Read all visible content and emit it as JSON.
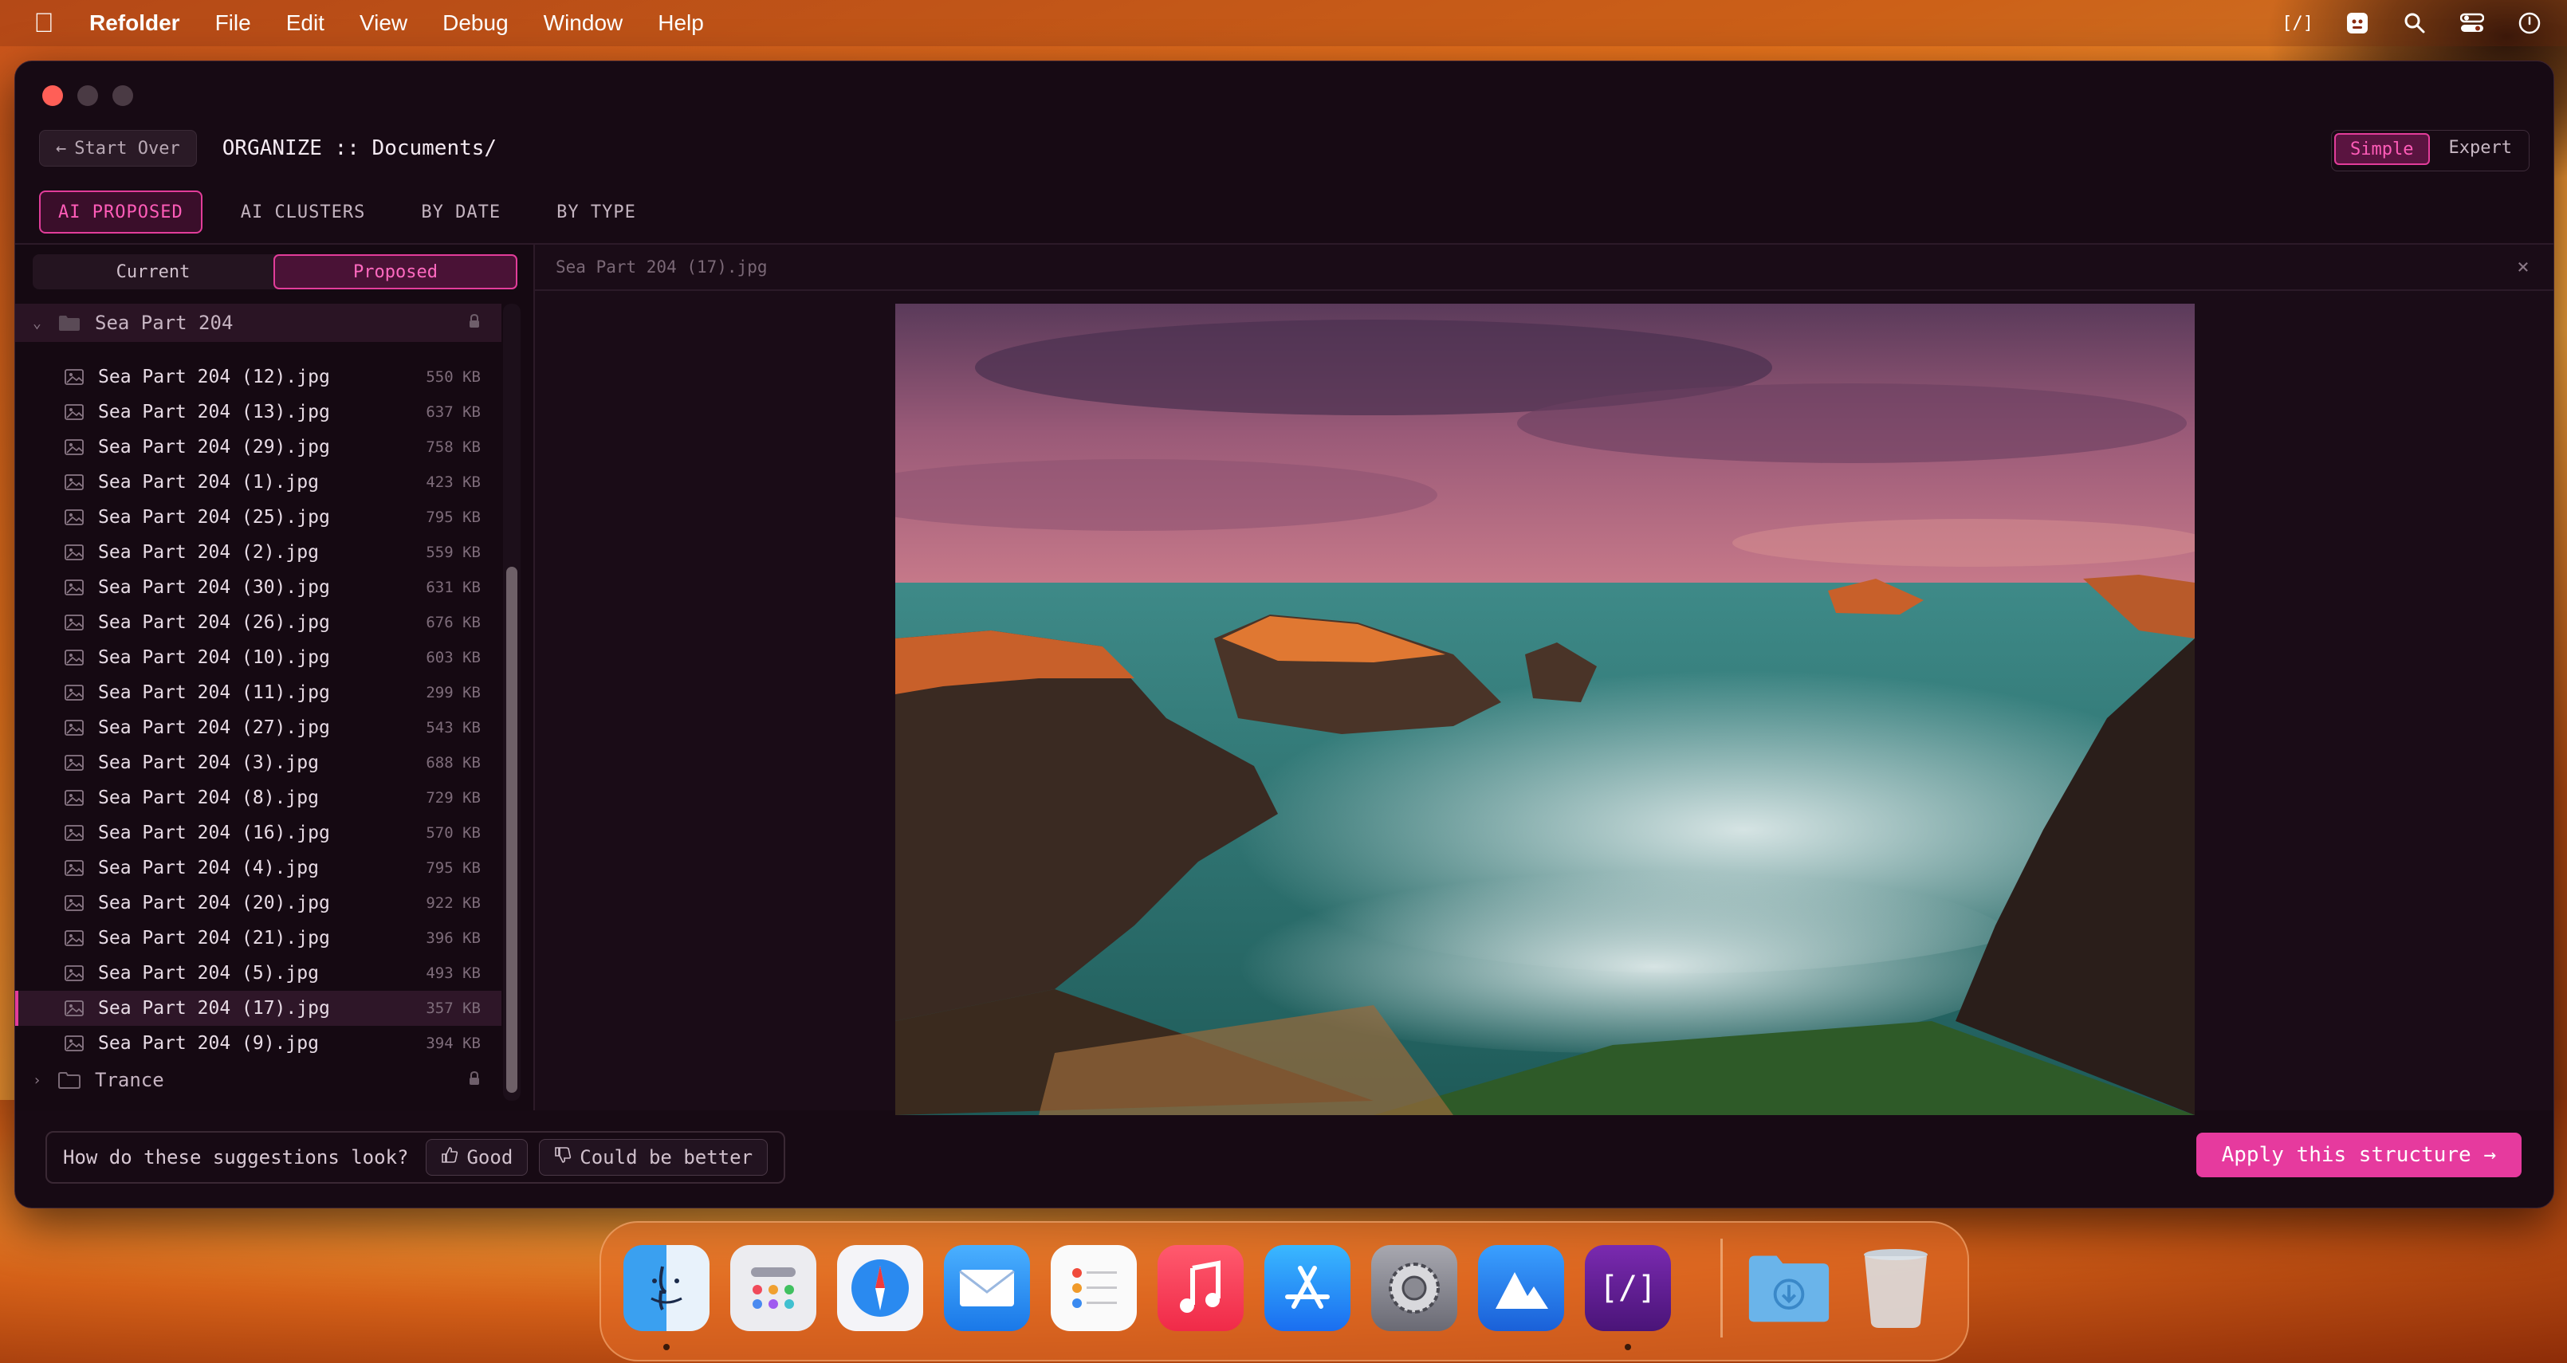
{
  "menubar": {
    "apple_icon": "apple-icon",
    "app_name": "Refolder",
    "items": [
      "File",
      "Edit",
      "View",
      "Debug",
      "Window",
      "Help"
    ],
    "status_app_label": "[/]"
  },
  "window": {
    "start_over_label": "Start Over",
    "title": "ORGANIZE :: Documents/",
    "mode_options": [
      "Simple",
      "Expert"
    ],
    "mode_selected": "Simple"
  },
  "tabs": [
    {
      "label": "AI PROPOSED",
      "active": true
    },
    {
      "label": "AI CLUSTERS",
      "active": false
    },
    {
      "label": "BY DATE",
      "active": false
    },
    {
      "label": "BY TYPE",
      "active": false
    }
  ],
  "view_toggle": {
    "options": [
      "Current",
      "Proposed"
    ],
    "selected": "Proposed"
  },
  "tree": {
    "open_folder": "Sea Part 204",
    "files": [
      {
        "name": "Sea Part 204 (12).jpg",
        "size": "550 KB"
      },
      {
        "name": "Sea Part 204 (13).jpg",
        "size": "637 KB"
      },
      {
        "name": "Sea Part 204 (29).jpg",
        "size": "758 KB"
      },
      {
        "name": "Sea Part 204 (1).jpg",
        "size": "423 KB"
      },
      {
        "name": "Sea Part 204 (25).jpg",
        "size": "795 KB"
      },
      {
        "name": "Sea Part 204 (2).jpg",
        "size": "559 KB"
      },
      {
        "name": "Sea Part 204 (30).jpg",
        "size": "631 KB"
      },
      {
        "name": "Sea Part 204 (26).jpg",
        "size": "676 KB"
      },
      {
        "name": "Sea Part 204 (10).jpg",
        "size": "603 KB"
      },
      {
        "name": "Sea Part 204 (11).jpg",
        "size": "299 KB"
      },
      {
        "name": "Sea Part 204 (27).jpg",
        "size": "543 KB"
      },
      {
        "name": "Sea Part 204 (3).jpg",
        "size": "688 KB"
      },
      {
        "name": "Sea Part 204 (8).jpg",
        "size": "729 KB"
      },
      {
        "name": "Sea Part 204 (16).jpg",
        "size": "570 KB"
      },
      {
        "name": "Sea Part 204 (4).jpg",
        "size": "795 KB"
      },
      {
        "name": "Sea Part 204 (20).jpg",
        "size": "922 KB"
      },
      {
        "name": "Sea Part 204 (21).jpg",
        "size": "396 KB"
      },
      {
        "name": "Sea Part 204 (5).jpg",
        "size": "493 KB"
      },
      {
        "name": "Sea Part 204 (17).jpg",
        "size": "357 KB",
        "selected": true
      },
      {
        "name": "Sea Part 204 (9).jpg",
        "size": "394 KB"
      }
    ],
    "closed_folder": "Trance"
  },
  "preview": {
    "filename": "Sea Part 204 (17).jpg",
    "close_glyph": "×"
  },
  "feedback": {
    "question": "How do these suggestions look?",
    "good_label": "Good",
    "better_label": "Could be better"
  },
  "apply": {
    "label": "Apply this structure →"
  },
  "dock": {
    "apps": [
      "Finder",
      "Launchpad",
      "Safari",
      "Mail",
      "Reminders",
      "Music",
      "App Store",
      "System Settings",
      "Instruments",
      "Refolder",
      "Downloads",
      "Trash"
    ]
  },
  "colors": {
    "accent": "#e23d9a",
    "window_bg": "#170a14",
    "apply_button": "#e63a9e"
  }
}
